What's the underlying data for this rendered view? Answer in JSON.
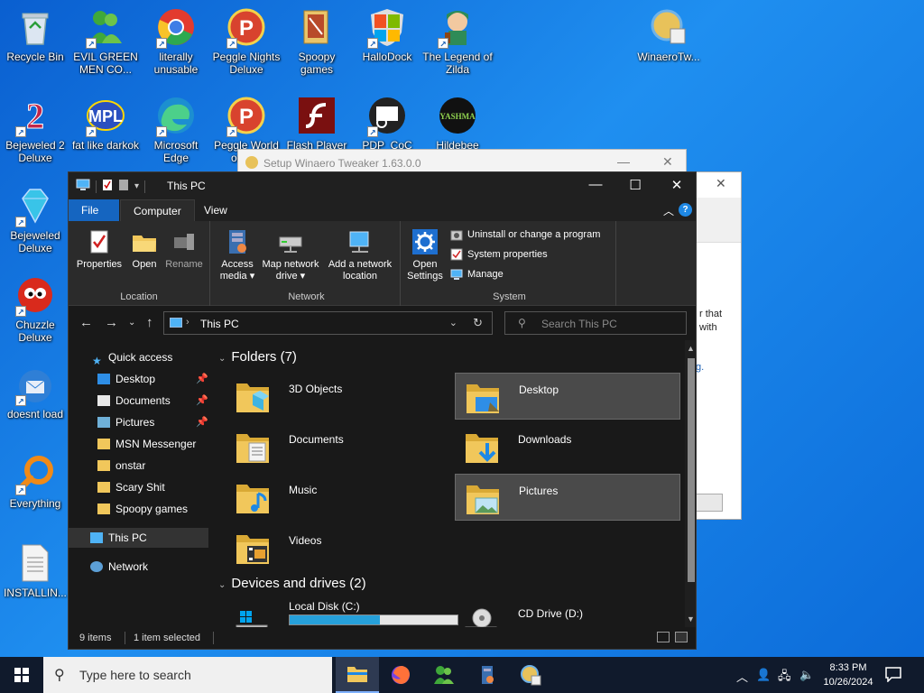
{
  "desktop": {
    "icons": [
      {
        "label": "Recycle Bin",
        "icon": "recycle-bin-icon",
        "color": "#c8d4e4"
      },
      {
        "label": "EVIL GREEN MEN CO...",
        "icon": "msn-men-icon",
        "color": "#3fa83a"
      },
      {
        "label": "literally unusable",
        "icon": "chrome-icon",
        "color": "#e33b2e"
      },
      {
        "label": "Peggle Nights Deluxe",
        "icon": "peggle-icon",
        "color": "#d8432e"
      },
      {
        "label": "Spoopy games",
        "icon": "folder-icon",
        "color": "#e9c46a"
      },
      {
        "label": "HalloDock",
        "icon": "windows-shield-icon",
        "color": "#f2b01e"
      },
      {
        "label": "The Legend of Zilda",
        "icon": "game-character-icon",
        "color": "#4a6fb0"
      },
      {
        "label": "WinaeroTw...",
        "icon": "winaero-icon",
        "color": "#e8c25a"
      },
      {
        "label": "Bejeweled 2 Deluxe",
        "icon": "bejeweled-icon",
        "color": "#c0264a"
      },
      {
        "label": "fat like darkok",
        "icon": "mpl-icon",
        "color": "#2a50c0"
      },
      {
        "label": "Microsoft Edge",
        "icon": "edge-icon",
        "color": "#1c8fd0"
      },
      {
        "label": "Peggle World of W...",
        "icon": "peggle-icon",
        "color": "#d8432e"
      },
      {
        "label": "Flash Player",
        "icon": "flash-icon",
        "color": "#7a1010"
      },
      {
        "label": "PDP_CoC",
        "icon": "pdp-icon",
        "color": "#222222"
      },
      {
        "label": "Hildebee",
        "icon": "yashma-icon",
        "color": "#111111"
      },
      {
        "label": "Bejeweled Deluxe",
        "icon": "diamond-icon",
        "color": "#39c4e8"
      },
      {
        "label": "Chuzzle Deluxe",
        "icon": "chuzzle-icon",
        "color": "#d92a1c"
      },
      {
        "label": "doesnt load",
        "icon": "thunderbird-icon",
        "color": "#2f7fd6"
      },
      {
        "label": "Everything",
        "icon": "magnifier-icon",
        "color": "#f08a18"
      },
      {
        "label": "INSTALLIN...",
        "icon": "text-file-icon",
        "color": "#f4f4f4"
      }
    ],
    "yashma_text": "YASHMA"
  },
  "setup_window": {
    "title": "Setup Winaero Tweaker 1.63.0.0",
    "partial_text_line1": "r that",
    "partial_text_line2": "with",
    "partial_link": "g."
  },
  "explorer": {
    "title": "This PC",
    "tabs": {
      "file": "File",
      "computer": "Computer",
      "view": "View"
    },
    "help": "?",
    "ribbon": {
      "location": {
        "group": "Location",
        "properties": "Properties",
        "open": "Open",
        "rename": "Rename"
      },
      "network": {
        "group": "Network",
        "access_media_1": "Access",
        "access_media_2": "media ▾",
        "map_drive_1": "Map network",
        "map_drive_2": "drive ▾",
        "add_location_1": "Add a network",
        "add_location_2": "location"
      },
      "system": {
        "group": "System",
        "open_settings_1": "Open",
        "open_settings_2": "Settings",
        "uninstall": "Uninstall or change a program",
        "system_properties": "System properties",
        "manage": "Manage"
      }
    },
    "address": {
      "path": "This PC"
    },
    "search": {
      "placeholder": "Search This PC"
    },
    "nav_pane": {
      "quick_access": "Quick access",
      "items": [
        {
          "label": "Desktop",
          "pinned": true
        },
        {
          "label": "Documents",
          "pinned": true
        },
        {
          "label": "Pictures",
          "pinned": true
        },
        {
          "label": "MSN Messenger",
          "pinned": false
        },
        {
          "label": "onstar",
          "pinned": false
        },
        {
          "label": "Scary Shit",
          "pinned": false
        },
        {
          "label": "Spoopy games",
          "pinned": false
        }
      ],
      "this_pc": "This PC",
      "network": "Network",
      "pin_glyph": "📌"
    },
    "folders_header": "Folders (7)",
    "folders": [
      {
        "name": "3D Objects",
        "selected": false
      },
      {
        "name": "Desktop",
        "selected": true
      },
      {
        "name": "Documents",
        "selected": false
      },
      {
        "name": "Downloads",
        "selected": false
      },
      {
        "name": "Music",
        "selected": false
      },
      {
        "name": "Pictures",
        "selected": true
      },
      {
        "name": "Videos",
        "selected": false
      }
    ],
    "devices_header": "Devices and drives (2)",
    "drives": [
      {
        "name": "Local Disk (C:)",
        "used_fraction": 0.54
      },
      {
        "name": "CD Drive (D:)"
      }
    ],
    "status": {
      "items": "9 items",
      "selected": "1 item selected"
    }
  },
  "taskbar": {
    "search_placeholder": "Type here to search",
    "time": "8:33 PM",
    "date": "10/26/2024"
  },
  "colors": {
    "accent": "#1565c0",
    "folder": "#f1c75b",
    "selection": "#4a4a4a"
  }
}
